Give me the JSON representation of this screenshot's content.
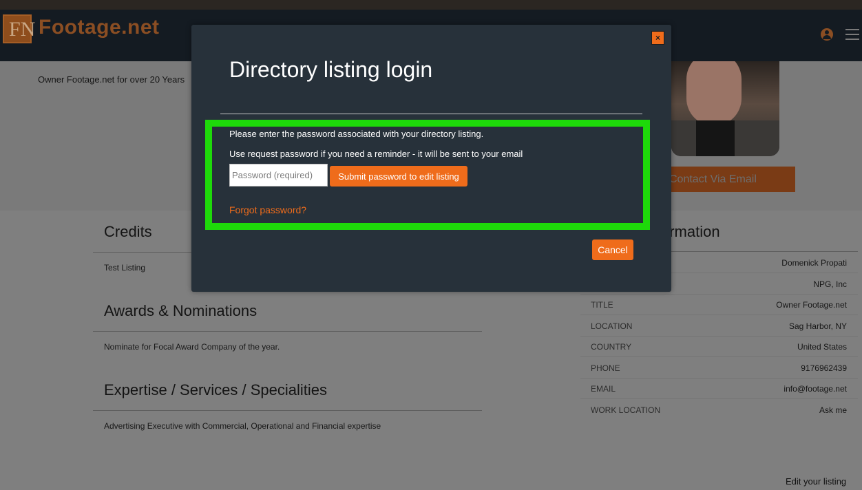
{
  "header": {
    "logo_letters": "FN",
    "logo_text": "Footage.net",
    "user_icon": "user-circle-icon",
    "menu_icon": "hamburger-menu-icon",
    "brand_color": "#ef6c1b"
  },
  "profile": {
    "tagline": "Owner Footage.net for over 20 Years",
    "contact_button": "Contact Via Email"
  },
  "sections": {
    "credits": {
      "title": "Credits",
      "text": "Test Listing"
    },
    "awards": {
      "title": "Awards & Nominations",
      "text": "Nominate for Focal Award Company of the year."
    },
    "expertise": {
      "title": "Expertise / Services / Specialities",
      "text": "Advertising Executive with Commercial, Operational and Financial expertise"
    }
  },
  "info": {
    "title_visible": "ormation",
    "rows": [
      {
        "key": "",
        "value": "Domenick Propati"
      },
      {
        "key": "",
        "value": "NPG, Inc"
      },
      {
        "key": "TITLE",
        "value": "Owner Footage.net"
      },
      {
        "key": "LOCATION",
        "value": "Sag Harbor, NY"
      },
      {
        "key": "COUNTRY",
        "value": "United States"
      },
      {
        "key": "PHONE",
        "value": "9176962439"
      },
      {
        "key": "EMAIL",
        "value": "info@footage.net"
      },
      {
        "key": "WORK LOCATION",
        "value": "Ask me"
      }
    ]
  },
  "edit_link": "Edit your listing",
  "modal": {
    "close_label": "×",
    "title": "Directory listing login",
    "line1": "Please enter the password associated with your directory listing.",
    "line2": "Use request password if you need a reminder - it will be sent to your email",
    "password_placeholder": "Password (required)",
    "submit_label": "Submit password to edit listing",
    "forgot_label": "Forgot password?",
    "cancel_label": "Cancel",
    "highlight_color": "#1ed90a"
  }
}
